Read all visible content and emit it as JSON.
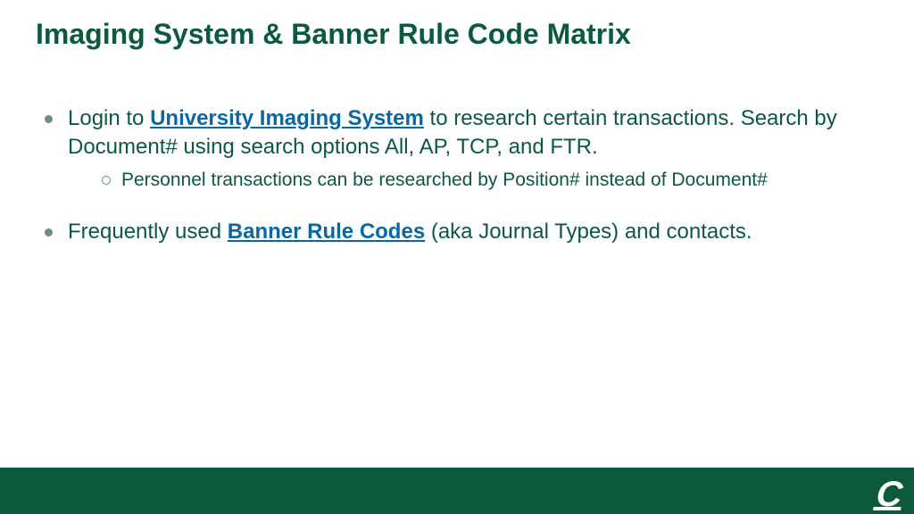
{
  "title": "Imaging System & Banner Rule Code Matrix",
  "bullets": [
    {
      "pre": "Login to ",
      "link": "University Imaging System",
      "post": " to research certain transactions. Search by Document# using search options All, AP, TCP, and FTR.",
      "sub": [
        "Personnel transactions can be researched by Position# instead of Document#"
      ]
    },
    {
      "pre": "Frequently used ",
      "link": "Banner Rule Codes",
      "post": " (aka Journal Types) and contacts."
    }
  ],
  "logo_letter": "C"
}
